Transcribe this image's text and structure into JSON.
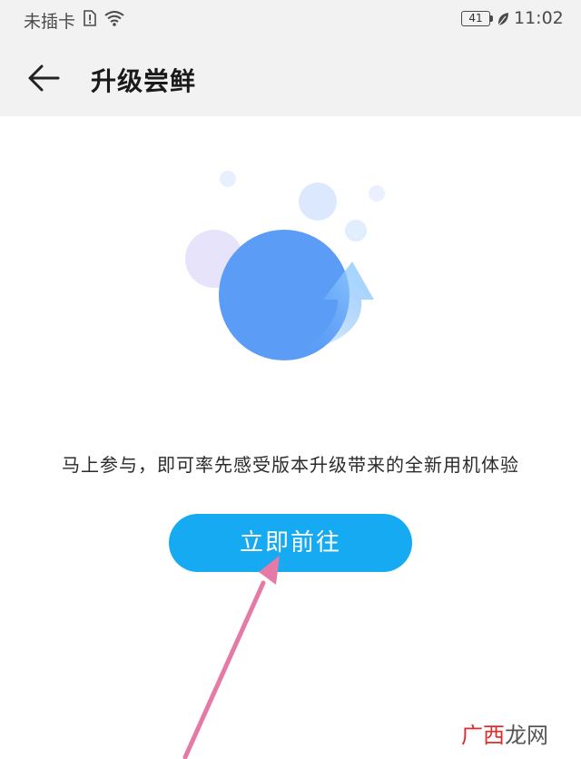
{
  "status_bar": {
    "carrier": "未插卡",
    "battery": "41",
    "time": "11:02"
  },
  "header": {
    "title": "升级尝鲜"
  },
  "main": {
    "description": "马上参与，即可率先感受版本升级带来的全新用机体验",
    "button_label": "立即前往"
  },
  "watermark": {
    "part1": "广西",
    "part2": "龙网"
  },
  "colors": {
    "accent": "#15aaf2",
    "illustration_blue": "#5b9cf6",
    "annotation_pink": "#e57aa6"
  }
}
